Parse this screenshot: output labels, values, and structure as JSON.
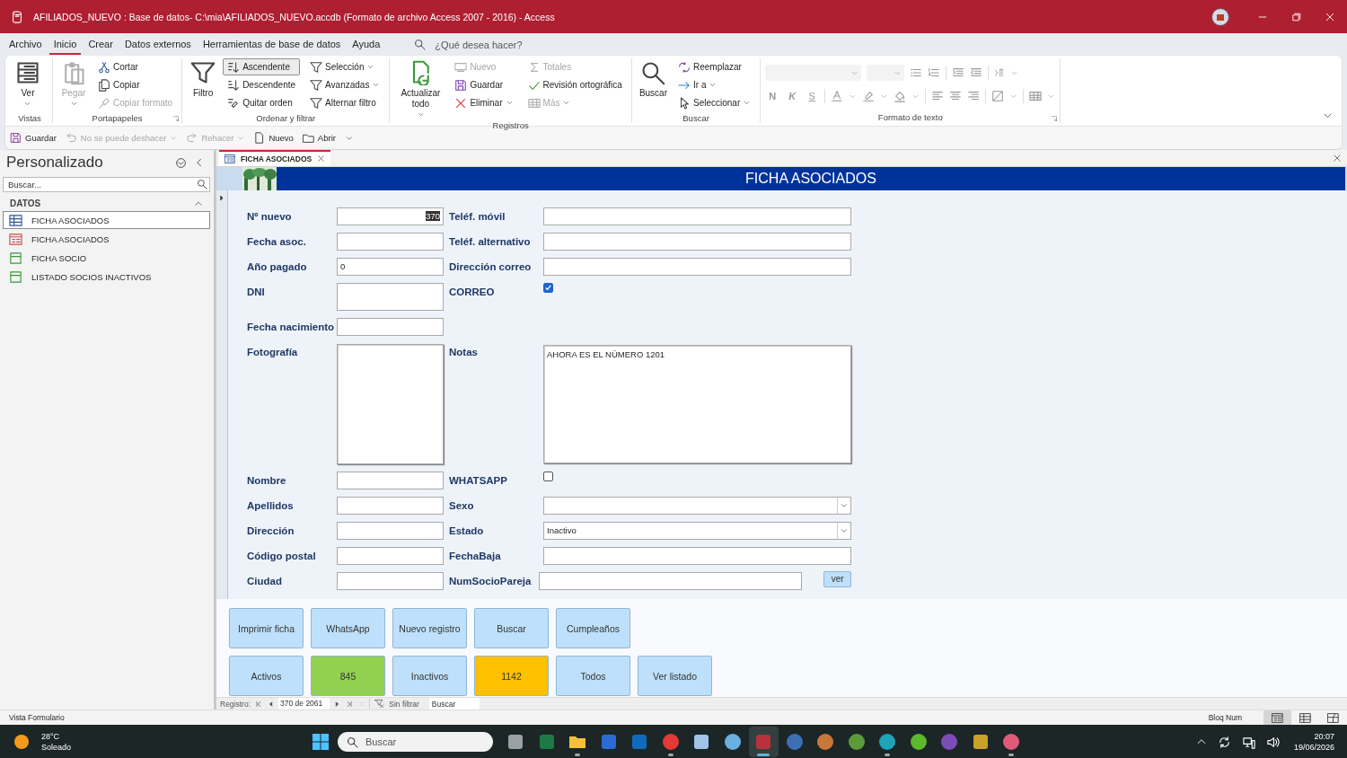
{
  "window": {
    "title": "AFILIADOS_NUEVO : Base de datos- C:\\mia\\AFILIADOS_NUEVO.accdb (Formato de archivo Access 2007 - 2016)  -  Access"
  },
  "menu": {
    "tabs": [
      {
        "label": "Archivo",
        "selected": false
      },
      {
        "label": "Inicio",
        "selected": true
      },
      {
        "label": "Crear",
        "selected": false
      },
      {
        "label": "Datos externos",
        "selected": false
      },
      {
        "label": "Herramientas de base de datos",
        "selected": false
      },
      {
        "label": "Ayuda",
        "selected": false
      }
    ],
    "tell_me": {
      "placeholder": "¿Qué desea hacer?"
    }
  },
  "ribbon": {
    "groups": [
      {
        "label": "Vistas",
        "kind": "buttons",
        "launcher": false,
        "items": [
          {
            "label": "Ver",
            "kind": "large",
            "dropdown": true,
            "disabled": false,
            "selected": false
          }
        ]
      },
      {
        "label": "Portapapeles",
        "kind": "buttons",
        "launcher": true,
        "items": [
          {
            "label": "Pegar",
            "kind": "large",
            "dropdown": true,
            "disabled": true,
            "selected": false
          },
          {
            "label": "Cortar",
            "kind": "small",
            "dropdown": false,
            "disabled": false,
            "selected": false
          },
          {
            "label": "Copiar",
            "kind": "small",
            "dropdown": false,
            "disabled": false,
            "selected": false
          },
          {
            "label": "Copiar formato",
            "kind": "small",
            "dropdown": false,
            "disabled": true,
            "selected": false
          }
        ]
      },
      {
        "label": "Ordenar y filtrar",
        "kind": "buttons",
        "launcher": false,
        "items": [
          {
            "label": "Filtro",
            "kind": "large",
            "dropdown": false,
            "disabled": false,
            "selected": false
          },
          {
            "label": "Ascendente",
            "kind": "small",
            "dropdown": false,
            "disabled": false,
            "selected": true
          },
          {
            "label": "Descendente",
            "kind": "small",
            "dropdown": false,
            "disabled": false,
            "selected": false
          },
          {
            "label": "Quitar orden",
            "kind": "small",
            "dropdown": false,
            "disabled": false,
            "selected": false
          },
          {
            "label": "Selección",
            "kind": "small",
            "dropdown": true,
            "disabled": false,
            "selected": false
          },
          {
            "label": "Avanzadas",
            "kind": "small",
            "dropdown": true,
            "disabled": false,
            "selected": false
          },
          {
            "label": "Alternar filtro",
            "kind": "small",
            "dropdown": false,
            "disabled": false,
            "selected": false
          }
        ]
      },
      {
        "label": "Registros",
        "kind": "buttons",
        "launcher": false,
        "items": [
          {
            "label": "Actualizar todo",
            "kind": "large",
            "dropdown": true,
            "disabled": false,
            "selected": false
          },
          {
            "label": "Nuevo",
            "kind": "small",
            "dropdown": false,
            "disabled": true,
            "selected": false
          },
          {
            "label": "Guardar",
            "kind": "small",
            "dropdown": false,
            "disabled": false,
            "selected": false
          },
          {
            "label": "Eliminar",
            "kind": "small",
            "dropdown": true,
            "disabled": false,
            "selected": false
          },
          {
            "label": "Totales",
            "kind": "small",
            "dropdown": false,
            "disabled": true,
            "selected": false
          },
          {
            "label": "Revisión ortográfica",
            "kind": "small",
            "dropdown": false,
            "disabled": false,
            "selected": false
          },
          {
            "label": "Más",
            "kind": "small",
            "dropdown": true,
            "disabled": true,
            "selected": false
          }
        ]
      },
      {
        "label": "Buscar",
        "kind": "buttons",
        "launcher": false,
        "items": [
          {
            "label": "Buscar",
            "kind": "large",
            "dropdown": false,
            "disabled": false,
            "selected": false
          },
          {
            "label": "Reemplazar",
            "kind": "small",
            "dropdown": false,
            "disabled": false,
            "selected": false
          },
          {
            "label": "Ir a",
            "kind": "small",
            "dropdown": true,
            "disabled": false,
            "selected": false
          },
          {
            "label": "Seleccionar",
            "kind": "small",
            "dropdown": true,
            "disabled": false,
            "selected": false
          }
        ]
      },
      {
        "label": "Formato de texto",
        "kind": "format",
        "launcher": true,
        "letters": [
          "N",
          "K",
          "S"
        ]
      }
    ]
  },
  "quick_access": [
    {
      "label": "Guardar",
      "disabled": false,
      "dropdown": false
    },
    {
      "label": "No se puede deshacer",
      "disabled": true,
      "dropdown": true
    },
    {
      "label": "Rehacer",
      "disabled": true,
      "dropdown": true
    },
    {
      "label": "Nuevo",
      "disabled": false,
      "dropdown": false
    },
    {
      "label": "Abrir",
      "disabled": false,
      "dropdown": false
    }
  ],
  "nav_pane": {
    "title": "Personalizado",
    "search": {
      "placeholder": "Buscar..."
    },
    "groups": [
      {
        "label": "DATOS",
        "expanded": true,
        "items": [
          {
            "label": "FICHA ASOCIADOS",
            "kind": "table",
            "selected": true
          },
          {
            "label": "FICHA ASOCIADOS",
            "kind": "form",
            "selected": false
          },
          {
            "label": "FICHA SOCIO",
            "kind": "report",
            "selected": false
          },
          {
            "label": "LISTADO SOCIOS INACTIVOS",
            "kind": "report",
            "selected": false
          }
        ]
      }
    ]
  },
  "document_tab": {
    "label": "FICHA ASOCIADOS"
  },
  "form": {
    "title": "FICHA ASOCIADOS",
    "rows": [
      {
        "kind": "single",
        "left": {
          "label": "Nº nuevo",
          "kind": "text",
          "value": "370",
          "highlighted": true
        },
        "right": {
          "label": "Teléf. móvil",
          "kind": "text"
        }
      },
      {
        "kind": "single",
        "left": {
          "label": "Fecha asoc.",
          "kind": "text"
        },
        "right": {
          "label": "Teléf. alternativo",
          "kind": "text"
        }
      },
      {
        "kind": "single",
        "left": {
          "label": "Año pagado",
          "kind": "text",
          "value": "0",
          "highlighted": false
        },
        "right": {
          "label": "Dirección correo",
          "kind": "text"
        }
      },
      {
        "kind": "tall",
        "left": {
          "label": "DNI",
          "kind": "text"
        },
        "right": {
          "label": "CORREO",
          "kind": "checkbox",
          "checked": true
        }
      },
      {
        "kind": "single",
        "left": {
          "label": "Fecha nacimiento",
          "kind": "text"
        }
      },
      {
        "kind": "box",
        "left": {
          "label": "Fotografía"
        },
        "right": {
          "label": "Notas",
          "kind": "memo",
          "value": "AHORA ES EL NÚMERO 1201"
        }
      },
      {
        "kind": "single",
        "left": {
          "label": "Nombre",
          "kind": "text"
        },
        "right": {
          "label": "WHATSAPP",
          "kind": "checkbox",
          "checked": false
        }
      },
      {
        "kind": "single",
        "left": {
          "label": "Apellidos",
          "kind": "text"
        },
        "right": {
          "label": "Sexo",
          "kind": "combo"
        }
      },
      {
        "kind": "single",
        "left": {
          "label": "Dirección",
          "kind": "text"
        },
        "right": {
          "label": "Estado",
          "kind": "combo",
          "value": "Inactivo"
        }
      },
      {
        "kind": "single",
        "left": {
          "label": "Código postal",
          "kind": "text"
        },
        "right": {
          "label": "FechaBaja",
          "kind": "text"
        }
      },
      {
        "kind": "single",
        "left": {
          "label": "Ciudad",
          "kind": "text"
        },
        "right": {
          "label": "NumSocioPareja",
          "kind": "text_button",
          "button": "ver"
        }
      }
    ],
    "buttons": [
      [
        {
          "label": "Imprimir ficha",
          "color": "#bfe0fa"
        },
        {
          "label": "WhatsApp",
          "color": "#bfe0fa"
        },
        {
          "label": "Nuevo registro",
          "color": "#bfe0fa"
        },
        {
          "label": "Buscar",
          "color": "#bfe0fa"
        },
        {
          "label": "Cumpleaños",
          "color": "#bfe0fa"
        }
      ],
      [
        {
          "label": "Activos",
          "color": "#bfe0fa"
        },
        {
          "label": "845",
          "color": "#92d050"
        },
        {
          "label": "Inactivos",
          "color": "#bfe0fa"
        },
        {
          "label": "1142",
          "color": "#ffc000"
        },
        {
          "label": "Todos",
          "color": "#bfe0fa"
        },
        {
          "label": "Ver listado",
          "color": "#bfe0fa"
        }
      ]
    ]
  },
  "record_nav": {
    "label": "Registro:",
    "position": "370 de 2061",
    "filter": "Sin filtrar",
    "search": {
      "placeholder": "Buscar"
    }
  },
  "status_bar": {
    "text": "Vista Formulario",
    "indicators": [
      "Bloq Num"
    ],
    "views": [
      {
        "selected": true
      },
      {
        "selected": false
      },
      {
        "selected": false
      }
    ]
  },
  "taskbar": {
    "weather": {
      "temperature": "28°C",
      "condition": "Soleado"
    },
    "search": {
      "placeholder": "Buscar"
    },
    "apps": [
      {
        "kind": "task_view",
        "running": false,
        "selected": false
      },
      {
        "kind": "spreadsheet",
        "running": false,
        "selected": false
      },
      {
        "kind": "folder",
        "running": true,
        "selected": false
      },
      {
        "kind": "document",
        "running": false,
        "selected": false
      },
      {
        "kind": "mail",
        "running": false,
        "selected": false
      },
      {
        "kind": "browser",
        "running": true,
        "selected": false
      },
      {
        "kind": "recycle",
        "running": false,
        "selected": false
      },
      {
        "kind": "bird",
        "running": false,
        "selected": false
      },
      {
        "kind": "database",
        "running": true,
        "selected": true
      },
      {
        "kind": "globe",
        "running": false,
        "selected": false
      },
      {
        "kind": "donkey",
        "running": false,
        "selected": false
      },
      {
        "kind": "plant",
        "running": false,
        "selected": false
      },
      {
        "kind": "wave",
        "running": true,
        "selected": false
      },
      {
        "kind": "money",
        "running": false,
        "selected": false
      },
      {
        "kind": "circle",
        "running": false,
        "selected": false
      },
      {
        "kind": "chest",
        "running": false,
        "selected": false
      },
      {
        "kind": "screen",
        "running": true,
        "selected": false
      }
    ],
    "time": "20:07",
    "date": "19/06/2026"
  }
}
